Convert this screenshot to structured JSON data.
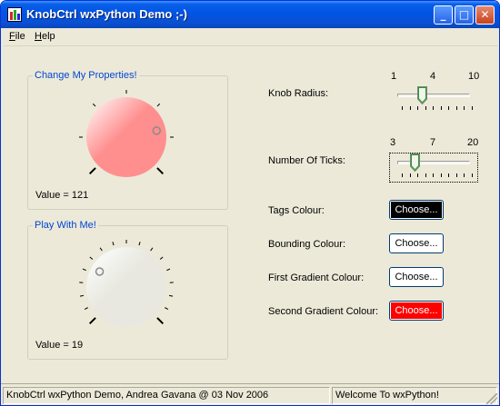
{
  "window": {
    "title": "KnobCtrl wxPython Demo ;-)",
    "buttons": {
      "minimize": "_",
      "maximize": "□",
      "close": "✕"
    }
  },
  "menubar": {
    "items": [
      {
        "accel": "F",
        "rest": "ile"
      },
      {
        "accel": "H",
        "rest": "elp"
      }
    ]
  },
  "knob1": {
    "group_label": "Change My Properties!",
    "value_text": "Value = 121",
    "value": 121,
    "face_color": "#ff8f8f",
    "tags_color": "#000000"
  },
  "knob2": {
    "group_label": "Play With Me!",
    "value_text": "Value = 19",
    "value": 19,
    "face_color": "#e8e8e0",
    "tags_color": "#000000"
  },
  "controls": {
    "knob_radius": {
      "label": "Knob Radius:",
      "min_label": "1",
      "mid_label": "4",
      "max_label": "10",
      "min": 1,
      "max": 10,
      "value": 4
    },
    "number_of_ticks": {
      "label": "Number Of Ticks:",
      "min_label": "3",
      "mid_label": "7",
      "max_label": "20",
      "min": 3,
      "max": 20,
      "value": 7
    },
    "tags_colour": {
      "label": "Tags Colour:",
      "button": "Choose...",
      "color": "#000000",
      "text_color": "#ffffff"
    },
    "bounding_colour": {
      "label": "Bounding Colour:",
      "button": "Choose...",
      "color": "#ffffff",
      "text_color": "#000000"
    },
    "first_gradient_colour": {
      "label": "First Gradient Colour:",
      "button": "Choose...",
      "color": "#ffffff",
      "text_color": "#000000"
    },
    "second_gradient_colour": {
      "label": "Second Gradient Colour:",
      "button": "Choose...",
      "color": "#ff0000",
      "text_color": "#ffffff"
    }
  },
  "statusbar": {
    "left": "KnobCtrl wxPython Demo, Andrea Gavana @ 03 Nov 2006",
    "right": "Welcome To wxPython!"
  }
}
